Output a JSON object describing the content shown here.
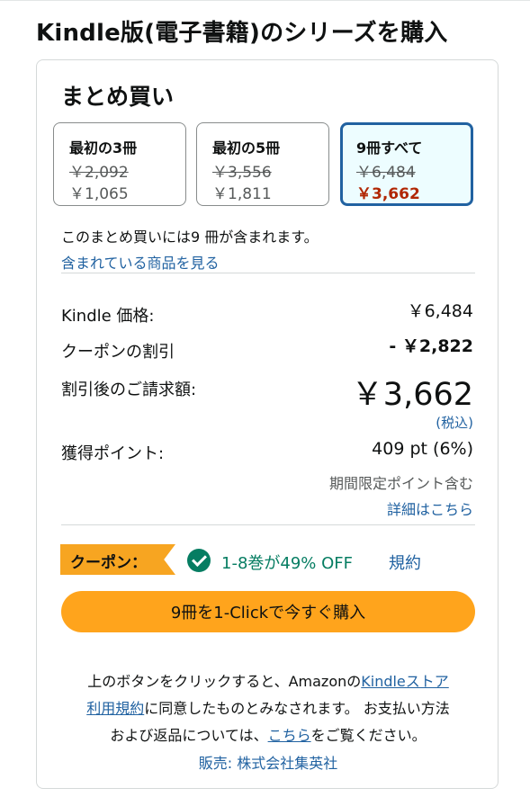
{
  "page": {
    "title": "Kindle版(電子書籍)のシリーズを購入"
  },
  "bundle": {
    "heading": "まとめ買い",
    "options": [
      {
        "label": "最初の3冊",
        "list_price": "￥2,092",
        "price": "￥1,065",
        "selected": false
      },
      {
        "label": "最初の5冊",
        "list_price": "￥3,556",
        "price": "￥1,811",
        "selected": false
      },
      {
        "label": "9冊すべて",
        "list_price": "￥6,484",
        "price": "￥3,662",
        "selected": true
      }
    ],
    "includes_text": "このまとめ買いには9 冊が含まれます。",
    "view_items_link": "含まれている商品を見る"
  },
  "pricing": {
    "kindle_price_label": "Kindle 価格:",
    "kindle_price": "￥6,484",
    "coupon_discount_label": "クーポンの割引",
    "coupon_discount": "- ￥2,822",
    "total_label": "割引後のご請求額:",
    "total": "￥3,662",
    "tax_note": "(税込)",
    "points_label": "獲得ポイント:",
    "points": "409 pt (6%)",
    "points_note": "期間限定ポイント含む",
    "points_details_link": "詳細はこちら"
  },
  "coupon": {
    "badge": "クーポン：",
    "text": "1-8巻が49% OFF",
    "terms_link": "規約"
  },
  "buy_button": "9冊を1-Clickで今すぐ購入",
  "legal": {
    "line1_prefix": "上のボタンをクリックすると、Amazonの",
    "line1_link": "Kindleストア",
    "line2_link": "利用規約",
    "line2_rest": "に同意したものとみなされます。 お支払い方法",
    "line3_prefix": "および返品については、",
    "line3_link": "こちら",
    "line3_suffix": "をご覧ください。"
  },
  "seller": "販売: 株式会社集英社",
  "colors": {
    "link": "#2162a1",
    "price_red": "#b12704",
    "coupon_green": "#067d62",
    "button_orange": "#ffa41c",
    "badge_orange": "#f7a521",
    "selected_border": "#2162a1"
  }
}
